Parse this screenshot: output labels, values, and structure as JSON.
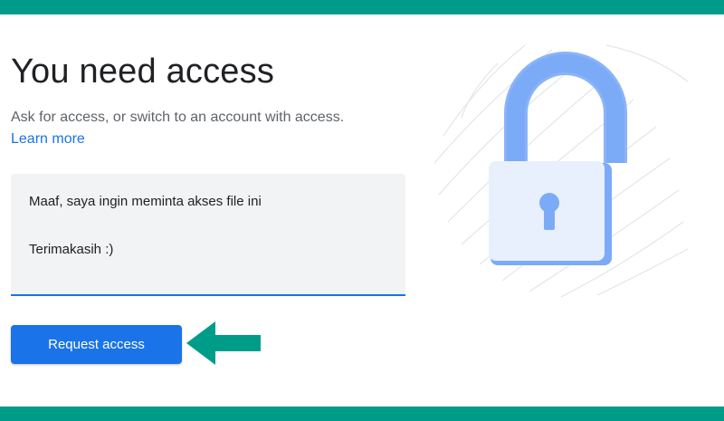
{
  "page": {
    "title": "You need access",
    "subtitle": "Ask for access, or switch to an account with access.",
    "learn_more": "Learn more"
  },
  "message": {
    "line1": "Maaf, saya ingin meminta akses file ini",
    "line2": "Terimakasih :)"
  },
  "actions": {
    "request_label": "Request access"
  },
  "colors": {
    "band": "#009c8a",
    "accent": "#1a73e8",
    "arrow": "#009c8a",
    "lock_body": "#e8f0fe",
    "lock_shackle": "#7baaf7"
  },
  "icons": {
    "illustration": "padlock-illustration",
    "pointer": "arrow-left-icon"
  }
}
